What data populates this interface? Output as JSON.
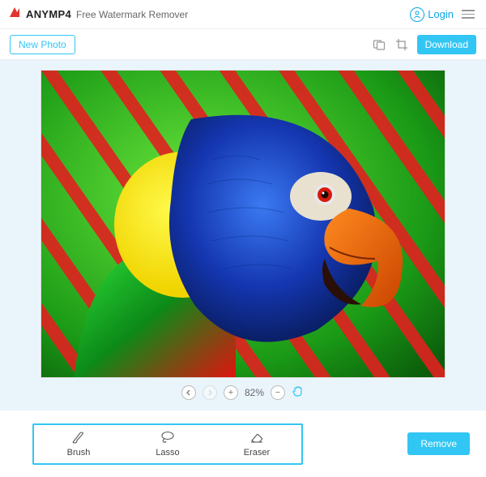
{
  "header": {
    "brand_name": "ANYMP4",
    "brand_sub": "Free Watermark Remover",
    "login_label": "Login"
  },
  "toolbar": {
    "new_photo_label": "New Photo",
    "download_label": "Download"
  },
  "zoom": {
    "value_label": "82%"
  },
  "tools": {
    "brush_label": "Brush",
    "lasso_label": "Lasso",
    "eraser_label": "Eraser"
  },
  "actions": {
    "remove_label": "Remove"
  }
}
